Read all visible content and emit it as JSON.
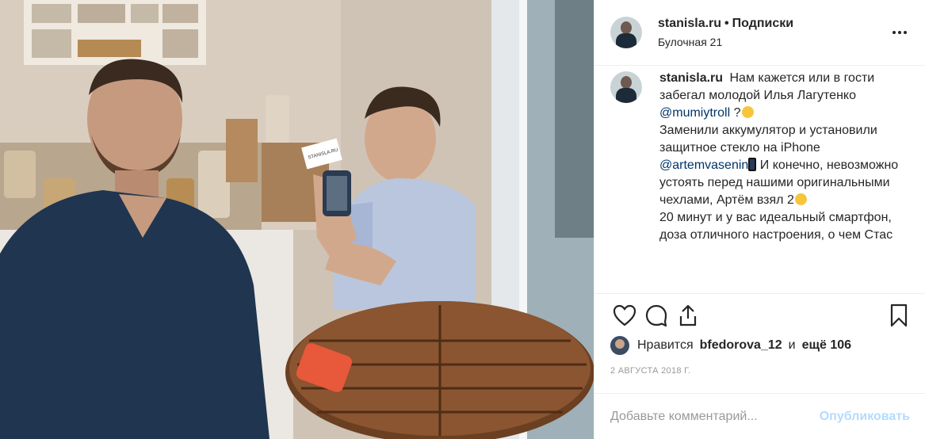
{
  "header": {
    "username": "stanisla.ru",
    "separator": "•",
    "follow_label": "Подписки",
    "location": "Булочная 21"
  },
  "caption": {
    "username": "stanisla.ru",
    "text_1": "Нам кажется или в гости забегал молодой Илья Лагутенко",
    "mention_1": "@mumiytroll",
    "text_2": "?",
    "text_3": "Заменили аккумулятор и установили защитное стекло на iPhone",
    "mention_2": "@artemvasenin",
    "text_4": "И конечно, невозможно устоять перед нашими оригинальными чехлами, Артём взял 2",
    "text_5": "20 минут и у вас идеальный смартфон, доза отличного настроения, о чем Стас"
  },
  "likes": {
    "prefix": "Нравится",
    "user": "bfedorova_12",
    "conjunction": "и",
    "others": "ещё 106"
  },
  "date": "2 АВГУСТА 2018 Г.",
  "comment_input": {
    "placeholder": "Добавьте комментарий...",
    "post_label": "Опубликовать"
  },
  "photo": {
    "card_text": "STANISLA.RU"
  },
  "icons": {
    "more": "more-horizontal-icon",
    "like": "heart-icon",
    "comment": "comment-bubble-icon",
    "share": "share-icon",
    "save": "bookmark-icon"
  },
  "colors": {
    "text": "#262626",
    "secondary": "#999999",
    "mention": "#003569",
    "post_button_disabled": "#b3dbff",
    "divider": "#efefef"
  }
}
